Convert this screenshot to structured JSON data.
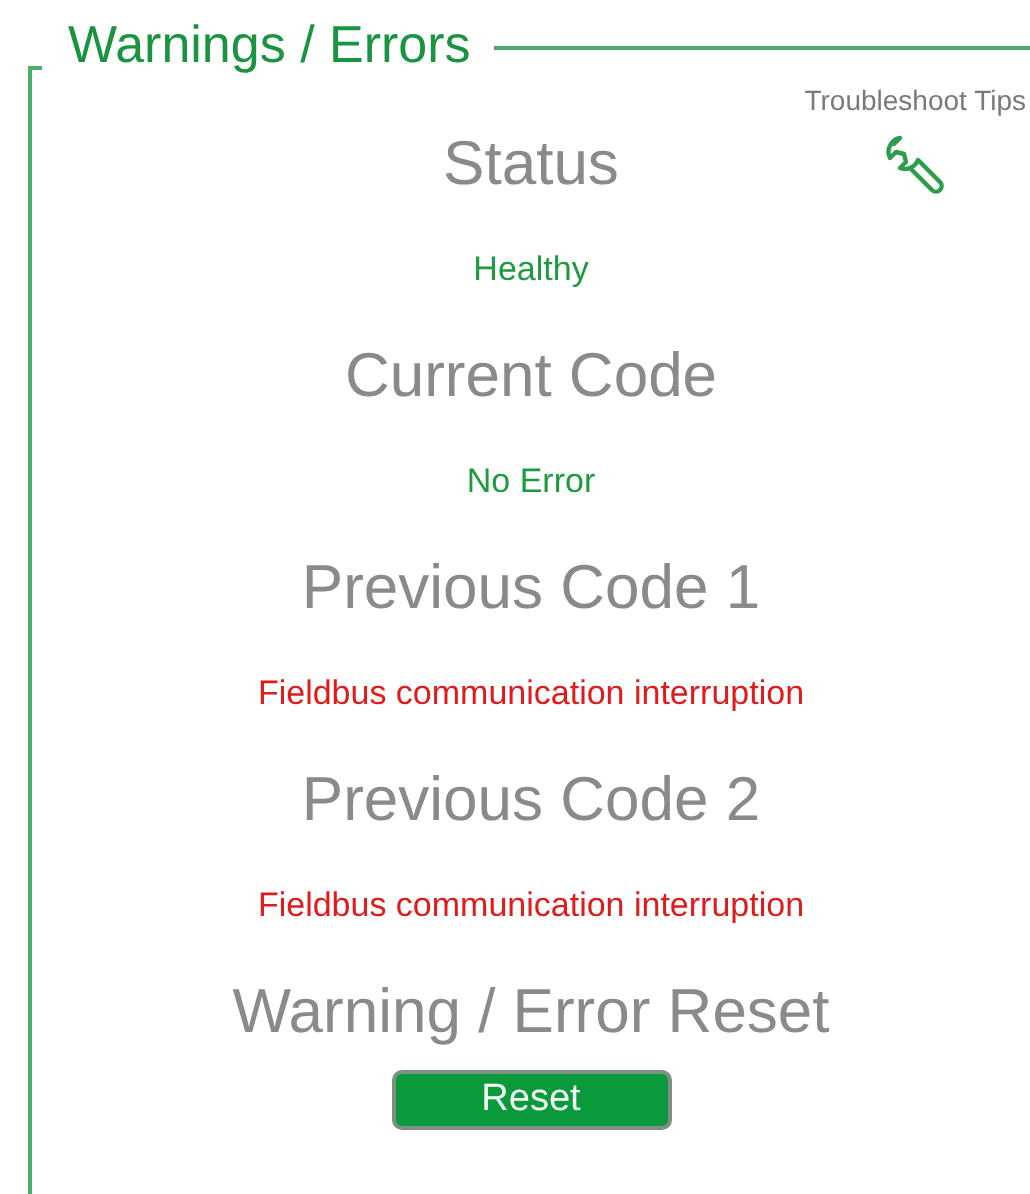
{
  "panel": {
    "title": "Warnings / Errors"
  },
  "tips": {
    "label": "Troubleshoot Tips"
  },
  "rows": [
    {
      "kind": "heading",
      "text": "Status"
    },
    {
      "kind": "ok",
      "text": "Healthy"
    },
    {
      "kind": "heading",
      "text": "Current Code"
    },
    {
      "kind": "ok",
      "text": "No Error"
    },
    {
      "kind": "heading",
      "text": "Previous Code 1"
    },
    {
      "kind": "error",
      "text": "Fieldbus communication interruption"
    },
    {
      "kind": "heading",
      "text": "Previous Code 2"
    },
    {
      "kind": "error",
      "text": "Fieldbus communication interruption"
    },
    {
      "kind": "heading",
      "text": "Warning / Error Reset"
    }
  ],
  "reset_button": {
    "label": "Reset"
  }
}
